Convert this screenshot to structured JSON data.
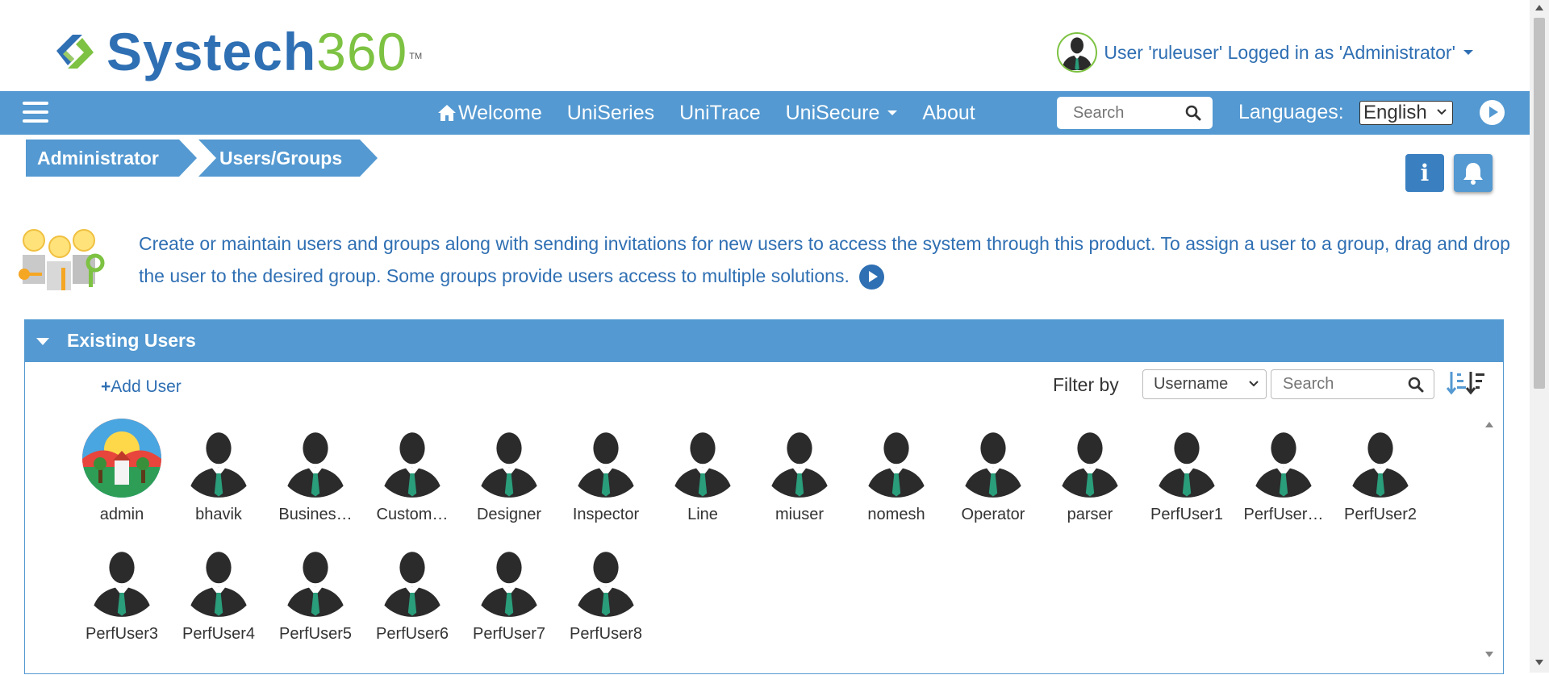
{
  "header": {
    "logo_text_a": "Systech",
    "logo_text_b": "360",
    "logo_tm": "TM",
    "user_status": "User 'ruleuser' Logged in as 'Administrator'"
  },
  "nav": {
    "items": [
      {
        "label": "Welcome",
        "icon": "home-icon"
      },
      {
        "label": "UniSeries"
      },
      {
        "label": "UniTrace"
      },
      {
        "label": "UniSecure",
        "dropdown": true
      },
      {
        "label": "About"
      }
    ],
    "search_placeholder": "Search",
    "languages_label": "Languages:",
    "language_selected": "English"
  },
  "breadcrumb": [
    "Administrator",
    "Users/Groups"
  ],
  "intro": {
    "text": "Create or maintain users and groups along with sending invitations for new users to access the system through this product. To assign a user to a group, drag and drop the user to the desired group. Some groups provide users access to multiple solutions."
  },
  "panel": {
    "title": "Existing Users",
    "add_user_label": "Add User",
    "filter_label": "Filter by",
    "filter_selected": "Username",
    "search_placeholder": "Search"
  },
  "users": [
    {
      "name": "admin",
      "custom_avatar": true
    },
    {
      "name": "bhavik"
    },
    {
      "name": "Busines…"
    },
    {
      "name": "Custom…"
    },
    {
      "name": "Designer"
    },
    {
      "name": "Inspector"
    },
    {
      "name": "Line"
    },
    {
      "name": "miuser"
    },
    {
      "name": "nomesh"
    },
    {
      "name": "Operator"
    },
    {
      "name": "parser"
    },
    {
      "name": "PerfUser1"
    },
    {
      "name": "PerfUser…"
    },
    {
      "name": "PerfUser2"
    },
    {
      "name": "PerfUser3"
    },
    {
      "name": "PerfUser4"
    },
    {
      "name": "PerfUser5"
    },
    {
      "name": "PerfUser6"
    },
    {
      "name": "PerfUser7"
    },
    {
      "name": "PerfUser8"
    }
  ],
  "colors": {
    "primary": "#5499d1",
    "link": "#2f6fb3",
    "brand_green": "#7dc242",
    "avatar_tie": "#2a9d7a"
  }
}
